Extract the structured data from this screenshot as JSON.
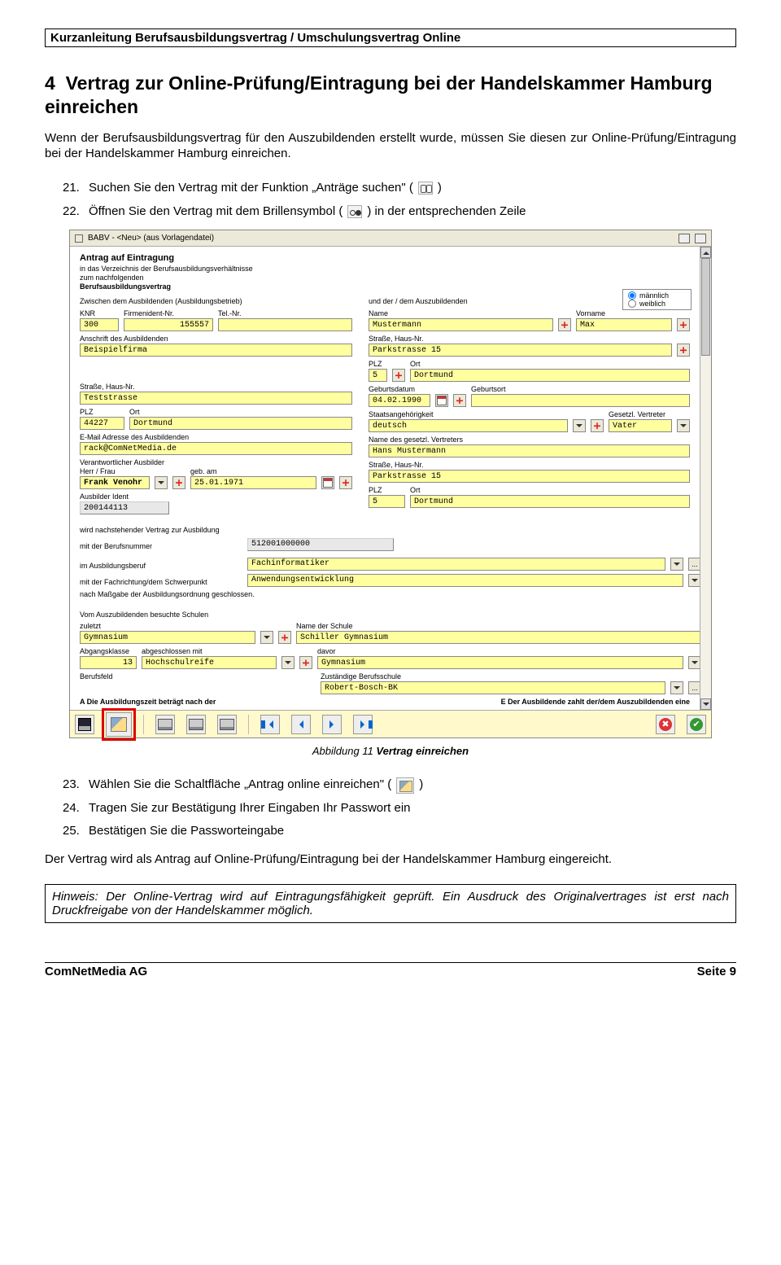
{
  "header": "Kurzanleitung Berufsausbildungsvertrag / Umschulungsvertrag Online",
  "section_number": "4",
  "section_title": "Vertrag zur Online-Prüfung/Eintragung bei der Handelskammer Hamburg einreichen",
  "intro": "Wenn der Berufsausbildungsvertrag für den Auszubildenden erstellt wurde, müssen Sie diesen zur Online-Prüfung/Eintragung bei der Handelskammer Hamburg einreichen.",
  "steps_a": [
    {
      "n": "21.",
      "t1": "Suchen Sie den Vertrag mit der Funktion „Anträge suchen\" (",
      "t2": ")"
    },
    {
      "n": "22.",
      "t1": "Öffnen Sie den Vertrag mit dem Brillensymbol (",
      "t2": ") in der entsprechenden Zeile"
    }
  ],
  "caption": {
    "prefix": "Abbildung 11 ",
    "bold": "Vertrag einreichen"
  },
  "steps_b": [
    {
      "n": "23.",
      "t1": "Wählen Sie die Schaltfläche „Antrag online einreichen\" (",
      "t2": ")"
    },
    {
      "n": "24.",
      "t1": "Tragen Sie zur Bestätigung Ihrer Eingaben Ihr Passwort ein",
      "t2": ""
    },
    {
      "n": "25.",
      "t1": "Bestätigen Sie die Passworteingabe",
      "t2": ""
    }
  ],
  "outro": "Der Vertrag wird als Antrag auf Online-Prüfung/Eintragung bei der Handelskammer Hamburg eingereicht.",
  "note": "Hinweis: Der Online-Vertrag wird auf Eintragungsfähigkeit geprüft. Ein Ausdruck des Originalvertrages ist erst nach Druckfreigabe von der Handelskammer möglich.",
  "footer": {
    "left": "ComNetMedia AG",
    "right": "Seite 9"
  },
  "form": {
    "window_title": "BABV - <Neu> (aus Vorlagendatei)",
    "h_title": "Antrag auf Eintragung",
    "h_sub1": "in das Verzeichnis der Berufsausbildungsverhältnisse",
    "h_sub2": "zum nachfolgenden",
    "h_sub3": "Berufsausbildungsvertrag",
    "lbl_left_party": "Zwischen dem Ausbildenden (Ausbildungsbetrieb)",
    "lbl_right_party": "und der / dem Auszubildenden",
    "gender": {
      "m": "männlich",
      "w": "weiblich"
    },
    "left": {
      "lbl_knr": "KNR",
      "lbl_firmid": "Firmenident-Nr.",
      "lbl_tel": "Tel.-Nr.",
      "knr": "300",
      "firmid": "155557",
      "tel": "",
      "lbl_anschrift": "Anschrift des Ausbildenden",
      "anschrift": "Beispielfirma",
      "lbl_strasse": "Straße, Haus-Nr.",
      "strasse": "Teststrasse",
      "lbl_plz": "PLZ",
      "plz": "44227",
      "lbl_ort": "Ort",
      "ort": "Dortmund",
      "lbl_email": "E-Mail Adresse des Ausbildenden",
      "email": "rack@ComNetMedia.de",
      "lbl_verantw": "Verantwortlicher Ausbilder",
      "lbl_herrfrau": "Herr / Frau",
      "lbl_geb": "geb. am",
      "herrfrau": "Frank Venohr",
      "geb": "25.01.1971",
      "lbl_ausbid": "Ausbilder Ident",
      "ausbid": "200144113"
    },
    "right": {
      "lbl_name": "Name",
      "lbl_vorname": "Vorname",
      "name": "Mustermann",
      "vorname": "Max",
      "lbl_strasse": "Straße, Haus-Nr.",
      "strasse": "Parkstrasse 15",
      "lbl_plz": "PLZ",
      "plz": "5",
      "lbl_ort": "Ort",
      "ort": "Dortmund",
      "lbl_gebdat": "Geburtsdatum",
      "gebdat": "04.02.1990",
      "lbl_gebort": "Geburtsort",
      "gebort": "",
      "lbl_staat": "Staatsangehörigkeit",
      "staat": "deutsch",
      "lbl_gesetzl": "Gesetzl. Vertreter",
      "gesetzl": "Vater",
      "lbl_vertr_name": "Name des gesetzl. Vertreters",
      "vertr_name": "Hans Mustermann",
      "lbl_vertr_str": "Straße, Haus-Nr.",
      "vertr_str": "Parkstrasse 15",
      "lbl_vertr_plz": "PLZ",
      "vertr_plz": "5",
      "lbl_vertr_ort": "Ort",
      "vertr_ort": "Dortmund"
    },
    "mid": {
      "t1": "wird nachstehender Vertrag zur Ausbildung",
      "lbl_berufnr": "mit der Berufsnummer",
      "berufnr": "512001000000",
      "lbl_beruf": "im   Ausbildungsberuf",
      "beruf": "Fachinformatiker",
      "lbl_schwer": "mit der Fachrichtung/dem Schwerpunkt",
      "schwer": "Anwendungsentwicklung",
      "t2": "nach Maßgabe der Ausbildungsordnung geschlossen."
    },
    "low": {
      "t1": "Vom Auszubildenden besuchte Schulen",
      "lbl_zuletzt": "zuletzt",
      "zuletzt": "Gymnasium",
      "lbl_schule": "Name der Schule",
      "schule": "Schiller Gymnasium",
      "lbl_klasse": "Abgangsklasse",
      "klasse": "13",
      "lbl_absch": "abgeschlossen mit",
      "absch": "Hochschulreife",
      "lbl_davor": "davor",
      "davor": "Gymnasium",
      "lbl_bfeld": "Berufsfeld",
      "bfeld": "",
      "lbl_zust": "Zuständige Berufsschule",
      "zust": "Robert-Bosch-BK",
      "tA": "A   Die Ausbildungszeit beträgt nach der",
      "tE": "E Der Ausbildende zahlt der/dem Auszubildenden eine"
    }
  }
}
